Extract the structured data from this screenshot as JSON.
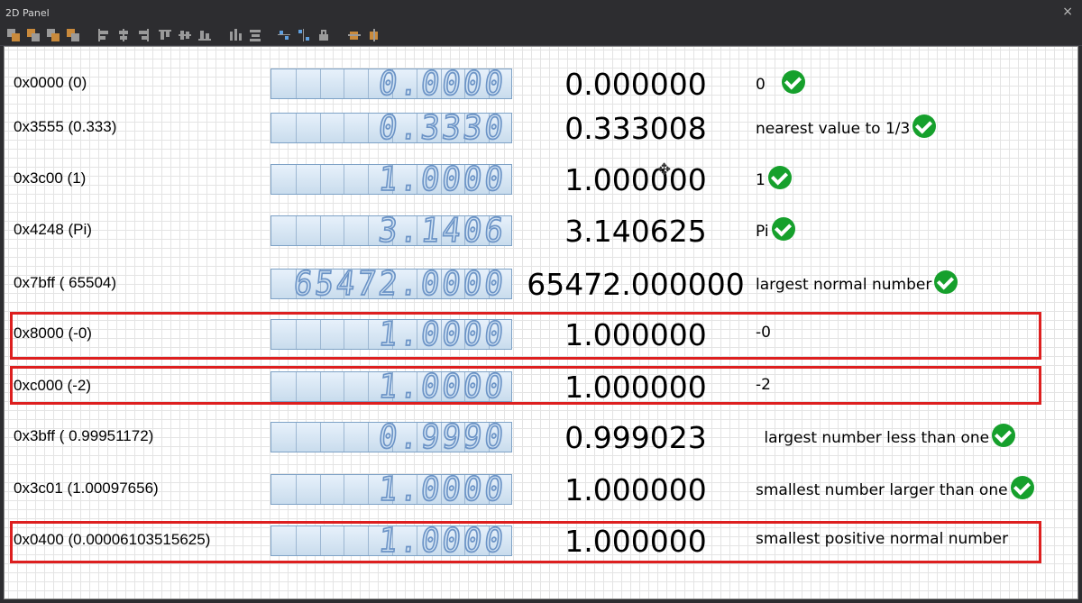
{
  "window": {
    "title": "2D Panel",
    "close_glyph": "×"
  },
  "toolbar": {
    "icons": [
      "send-back-icon",
      "bring-forward-icon",
      "send-backward-icon",
      "bring-front-icon",
      "align-left-icon",
      "align-center-icon",
      "align-right-icon",
      "align-top-icon",
      "align-middle-icon",
      "align-bottom-icon",
      "distribute-h-icon",
      "distribute-v-icon",
      "group-icon",
      "ungroup-icon",
      "lock-icon",
      "cut-icon",
      "delete-icon"
    ]
  },
  "rows": [
    {
      "hex": "0x0000  (0)",
      "display": "0.0000",
      "value": "0.000000",
      "desc": "0",
      "check": true,
      "highlight": false
    },
    {
      "hex": "0x3555  (0.333)",
      "display": "0.3330",
      "value": "0.333008",
      "desc": "nearest value to 1/3",
      "check": true,
      "highlight": false
    },
    {
      "hex": "0x3c00  (1)",
      "display": "1.0000",
      "value": "1.000000",
      "desc": "1",
      "check": true,
      "highlight": false
    },
    {
      "hex": "0x4248  (Pi)",
      "display": "3.1406",
      "value": "3.140625",
      "desc": "Pi",
      "check": true,
      "highlight": false
    },
    {
      "hex": "0x7bff ( 65504)",
      "display": "65472.0000",
      "value": "65472.000000",
      "desc": "largest normal number",
      "check": true,
      "highlight": false
    },
    {
      "hex": "0x8000 (-0)",
      "display": "1.0000",
      "value": "1.000000",
      "desc": "-0",
      "check": false,
      "highlight": true
    },
    {
      "hex": "0xc000  (-2)",
      "display": "1.0000",
      "value": "1.000000",
      "desc": "-2",
      "check": false,
      "highlight": true
    },
    {
      "hex": "0x3bff  ( 0.99951172)",
      "display": "0.9990",
      "value": "0.999023",
      "desc": " largest number less than one",
      "check": true,
      "highlight": false
    },
    {
      "hex": "0x3c01 (1.00097656)",
      "display": "1.0000",
      "value": "1.000000",
      "desc": "smallest number larger than one",
      "check": true,
      "highlight": false
    },
    {
      "hex": "0x0400  (0.00006103515625)",
      "display": "1.0000",
      "value": "1.000000",
      "desc": "smallest positive normal number",
      "check": false,
      "highlight": true
    }
  ],
  "colors": {
    "highlight": "#dd1f1f",
    "check": "#16a02c",
    "segment": "#6b93c6"
  }
}
